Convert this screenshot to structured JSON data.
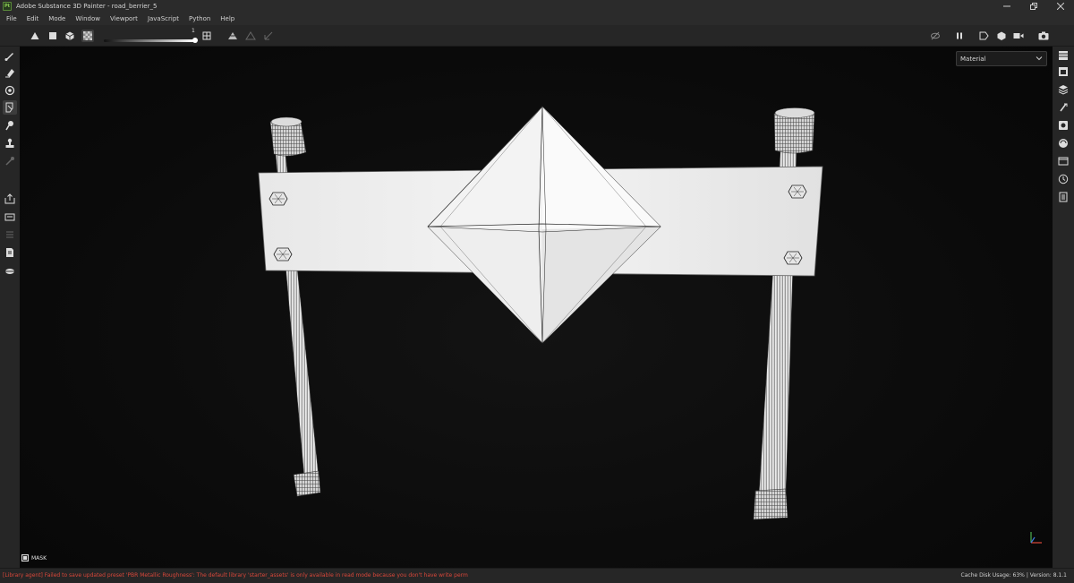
{
  "window": {
    "title": "Adobe Substance 3D Painter - road_berrier_5",
    "app_badge": "Pt"
  },
  "menu": [
    "File",
    "Edit",
    "Mode",
    "Window",
    "Viewport",
    "JavaScript",
    "Python",
    "Help"
  ],
  "toolbar": {
    "slider_value": "1"
  },
  "viewport": {
    "channel_select": "Material",
    "mask_label": "MASK"
  },
  "status": {
    "error": "[Library agent] Failed to save updated preset 'PBR Metallic Roughness': The default library 'starter_assets' is only available in read mode because you don't have write permi",
    "cache_label": "Cache Disk Usage:",
    "cache_value": "63%",
    "version": "| Version: 8.1.1"
  },
  "colors": {
    "accent_logo": "#8fcf56",
    "error_text": "#d9473a",
    "viewport_bg": "#0a0a0a"
  }
}
